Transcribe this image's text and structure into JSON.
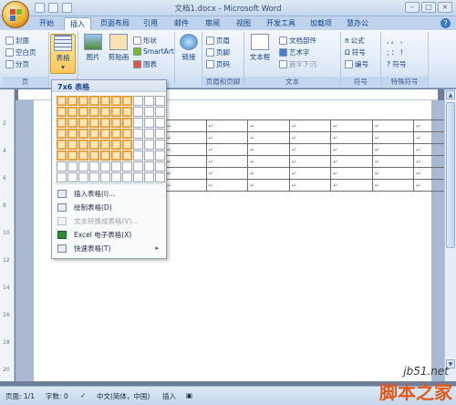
{
  "window": {
    "title": "文档1.docx - Microsoft Word"
  },
  "tabs": [
    "开始",
    "插入",
    "页面布局",
    "引用",
    "邮件",
    "审阅",
    "视图",
    "开发工具",
    "加载项",
    "慧办公"
  ],
  "active_tab": "插入",
  "ribbon": {
    "pages": {
      "cover": "封面",
      "blank": "空白页",
      "break": "分页",
      "group": "页"
    },
    "table": {
      "label": "表格"
    },
    "illustrations": {
      "picture": "图片",
      "clipart": "剪贴画",
      "shapes": "形状",
      "smartart": "SmartArt",
      "chart": "图表"
    },
    "links": {
      "label": "链接"
    },
    "header_footer": {
      "header": "页眉",
      "footer": "页脚",
      "page_number": "页码",
      "group": "页眉和页脚"
    },
    "text": {
      "textbox": "文本框",
      "quickparts": "文档部件",
      "wordart": "艺术字",
      "dropcap": "首字下沉",
      "group": "文本"
    },
    "symbols": {
      "equation": "公式",
      "symbol": "符号",
      "number": "编号",
      "group": "符号"
    },
    "special": {
      "group": "特殊符号",
      "row1": ", 。 、",
      "row2": "; ： !",
      "row3": "? 符号"
    }
  },
  "dropdown": {
    "header": "7x6 表格",
    "items": [
      {
        "label": "插入表格(I)...",
        "disabled": false
      },
      {
        "label": "绘制表格(D)",
        "disabled": false
      },
      {
        "label": "文本转换成表格(V)...",
        "disabled": true
      },
      {
        "label": "Excel 电子表格(X)",
        "disabled": false
      },
      {
        "label": "快速表格(T)",
        "disabled": false,
        "submenu": true
      }
    ],
    "grid": {
      "cols": 10,
      "rows": 8,
      "selected_cols": 7,
      "selected_rows": 6
    }
  },
  "document": {
    "table_cols": 7,
    "table_rows": 6,
    "cell_mark": "↵"
  },
  "statusbar": {
    "page": "页面: 1/1",
    "words": "字数: 0",
    "language": "中文(简体，中国)",
    "mode": "插入"
  },
  "watermark": {
    "url": "jb51.net",
    "site": "脚本之家"
  },
  "ruler_numbers": [
    "2",
    "4",
    "6",
    "8",
    "10",
    "12",
    "14",
    "16",
    "18",
    "20"
  ]
}
